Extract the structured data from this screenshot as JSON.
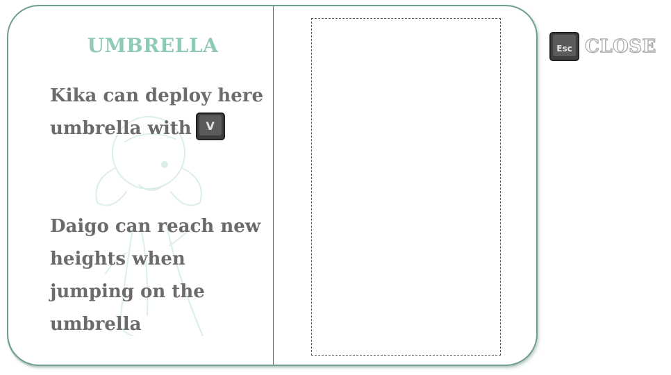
{
  "page": {
    "title": "UMBRELLA",
    "description_kika": "Kika can deploy here umbrella with",
    "description_daigo": "Daigo can reach new heights when jumping on the umbrella"
  },
  "keys": {
    "umbrella_key": "V",
    "close_key": "Esc"
  },
  "close_label": "CLOSE",
  "colors": {
    "title": "#8ecab4",
    "book_border": "#6f9e8c",
    "body_text": "#6b6b6b",
    "keycap": "#3e3e3e"
  },
  "icons": {
    "background": "character-illustration-watermark",
    "umbrella_key": "keycap-v-icon",
    "close_key": "keycap-esc-icon"
  }
}
